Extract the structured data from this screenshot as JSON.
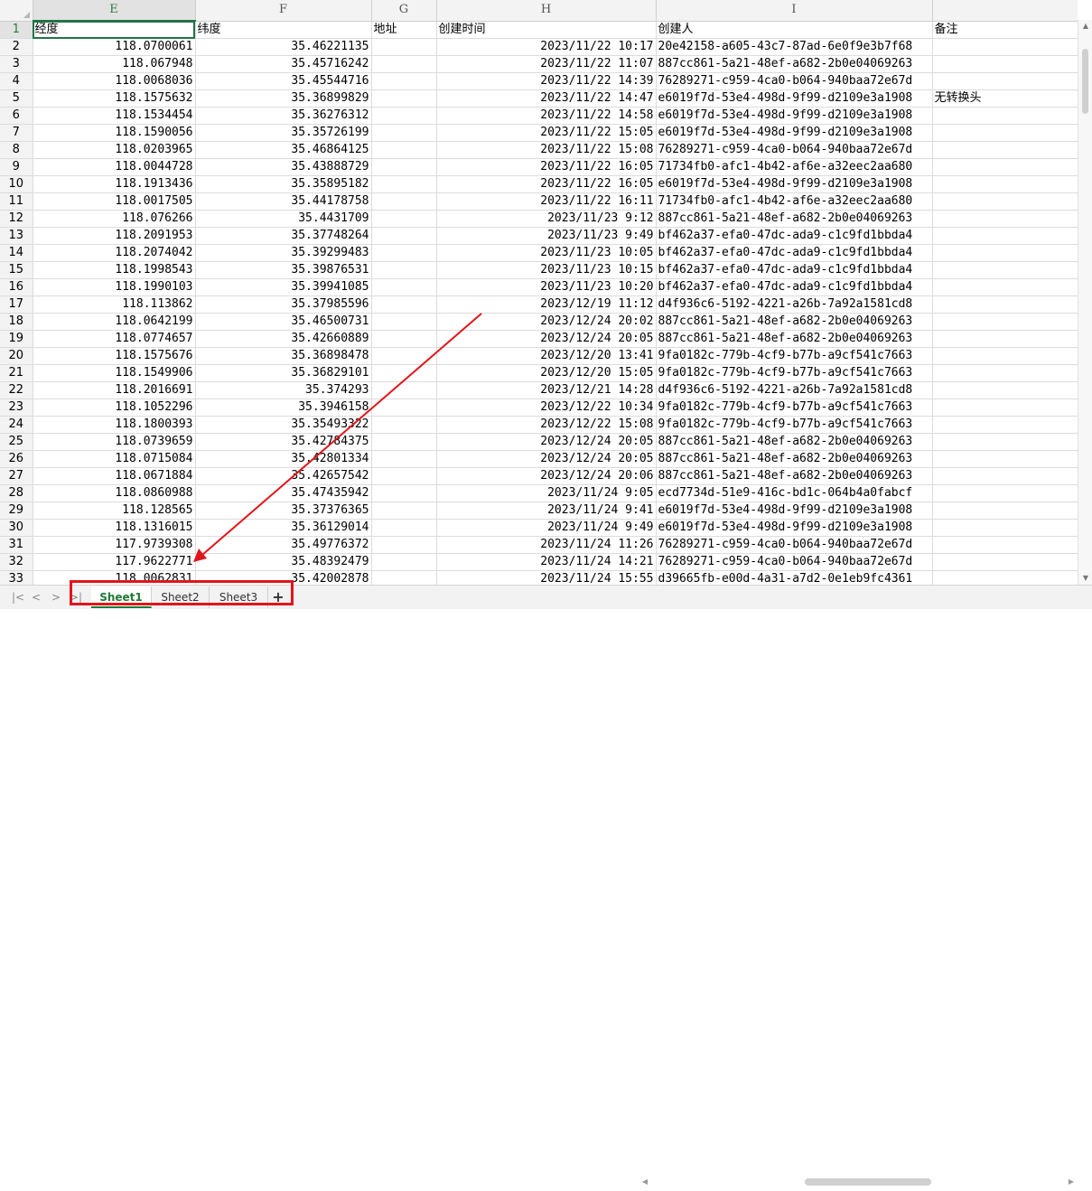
{
  "columns": [
    "E",
    "F",
    "G",
    "H",
    "I",
    ""
  ],
  "header_row": {
    "num": "1",
    "cells": [
      "经度",
      "纬度",
      "地址",
      "创建时间",
      "创建人",
      "备注"
    ]
  },
  "rows": [
    {
      "num": "2",
      "lng": "118.0700061",
      "lat": "35.46221135",
      "addr": "",
      "time": "2023/11/22 10:17",
      "creator": "20e42158-a605-43c7-87ad-6e0f9e3b7f68",
      "note": ""
    },
    {
      "num": "3",
      "lng": "118.067948",
      "lat": "35.45716242",
      "addr": "",
      "time": "2023/11/22 11:07",
      "creator": "887cc861-5a21-48ef-a682-2b0e04069263",
      "note": ""
    },
    {
      "num": "4",
      "lng": "118.0068036",
      "lat": "35.45544716",
      "addr": "",
      "time": "2023/11/22 14:39",
      "creator": "76289271-c959-4ca0-b064-940baa72e67d",
      "note": ""
    },
    {
      "num": "5",
      "lng": "118.1575632",
      "lat": "35.36899829",
      "addr": "",
      "time": "2023/11/22 14:47",
      "creator": "e6019f7d-53e4-498d-9f99-d2109e3a1908",
      "note": "无转换头"
    },
    {
      "num": "6",
      "lng": "118.1534454",
      "lat": "35.36276312",
      "addr": "",
      "time": "2023/11/22 14:58",
      "creator": "e6019f7d-53e4-498d-9f99-d2109e3a1908",
      "note": ""
    },
    {
      "num": "7",
      "lng": "118.1590056",
      "lat": "35.35726199",
      "addr": "",
      "time": "2023/11/22 15:05",
      "creator": "e6019f7d-53e4-498d-9f99-d2109e3a1908",
      "note": ""
    },
    {
      "num": "8",
      "lng": "118.0203965",
      "lat": "35.46864125",
      "addr": "",
      "time": "2023/11/22 15:08",
      "creator": "76289271-c959-4ca0-b064-940baa72e67d",
      "note": ""
    },
    {
      "num": "9",
      "lng": "118.0044728",
      "lat": "35.43888729",
      "addr": "",
      "time": "2023/11/22 16:05",
      "creator": "71734fb0-afc1-4b42-af6e-a32eec2aa680",
      "note": ""
    },
    {
      "num": "10",
      "lng": "118.1913436",
      "lat": "35.35895182",
      "addr": "",
      "time": "2023/11/22 16:05",
      "creator": "e6019f7d-53e4-498d-9f99-d2109e3a1908",
      "note": ""
    },
    {
      "num": "11",
      "lng": "118.0017505",
      "lat": "35.44178758",
      "addr": "",
      "time": "2023/11/22 16:11",
      "creator": "71734fb0-afc1-4b42-af6e-a32eec2aa680",
      "note": ""
    },
    {
      "num": "12",
      "lng": "118.076266",
      "lat": "35.4431709",
      "addr": "",
      "time": "2023/11/23 9:12",
      "creator": "887cc861-5a21-48ef-a682-2b0e04069263",
      "note": ""
    },
    {
      "num": "13",
      "lng": "118.2091953",
      "lat": "35.37748264",
      "addr": "",
      "time": "2023/11/23 9:49",
      "creator": "bf462a37-efa0-47dc-ada9-c1c9fd1bbda4",
      "note": ""
    },
    {
      "num": "14",
      "lng": "118.2074042",
      "lat": "35.39299483",
      "addr": "",
      "time": "2023/11/23 10:05",
      "creator": "bf462a37-efa0-47dc-ada9-c1c9fd1bbda4",
      "note": ""
    },
    {
      "num": "15",
      "lng": "118.1998543",
      "lat": "35.39876531",
      "addr": "",
      "time": "2023/11/23 10:15",
      "creator": "bf462a37-efa0-47dc-ada9-c1c9fd1bbda4",
      "note": ""
    },
    {
      "num": "16",
      "lng": "118.1990103",
      "lat": "35.39941085",
      "addr": "",
      "time": "2023/11/23 10:20",
      "creator": "bf462a37-efa0-47dc-ada9-c1c9fd1bbda4",
      "note": ""
    },
    {
      "num": "17",
      "lng": "118.113862",
      "lat": "35.37985596",
      "addr": "",
      "time": "2023/12/19 11:12",
      "creator": "d4f936c6-5192-4221-a26b-7a92a1581cd8",
      "note": ""
    },
    {
      "num": "18",
      "lng": "118.0642199",
      "lat": "35.46500731",
      "addr": "",
      "time": "2023/12/24 20:02",
      "creator": "887cc861-5a21-48ef-a682-2b0e04069263",
      "note": ""
    },
    {
      "num": "19",
      "lng": "118.0774657",
      "lat": "35.42660889",
      "addr": "",
      "time": "2023/12/24 20:05",
      "creator": "887cc861-5a21-48ef-a682-2b0e04069263",
      "note": ""
    },
    {
      "num": "20",
      "lng": "118.1575676",
      "lat": "35.36898478",
      "addr": "",
      "time": "2023/12/20 13:41",
      "creator": "9fa0182c-779b-4cf9-b77b-a9cf541c7663",
      "note": ""
    },
    {
      "num": "21",
      "lng": "118.1549906",
      "lat": "35.36829101",
      "addr": "",
      "time": "2023/12/20 15:05",
      "creator": "9fa0182c-779b-4cf9-b77b-a9cf541c7663",
      "note": ""
    },
    {
      "num": "22",
      "lng": "118.2016691",
      "lat": "35.374293",
      "addr": "",
      "time": "2023/12/21 14:28",
      "creator": "d4f936c6-5192-4221-a26b-7a92a1581cd8",
      "note": ""
    },
    {
      "num": "23",
      "lng": "118.1052296",
      "lat": "35.3946158",
      "addr": "",
      "time": "2023/12/22 10:34",
      "creator": "9fa0182c-779b-4cf9-b77b-a9cf541c7663",
      "note": ""
    },
    {
      "num": "24",
      "lng": "118.1800393",
      "lat": "35.35493322",
      "addr": "",
      "time": "2023/12/22 15:08",
      "creator": "9fa0182c-779b-4cf9-b77b-a9cf541c7663",
      "note": ""
    },
    {
      "num": "25",
      "lng": "118.0739659",
      "lat": "35.42784375",
      "addr": "",
      "time": "2023/12/24 20:05",
      "creator": "887cc861-5a21-48ef-a682-2b0e04069263",
      "note": ""
    },
    {
      "num": "26",
      "lng": "118.0715084",
      "lat": "35.42801334",
      "addr": "",
      "time": "2023/12/24 20:05",
      "creator": "887cc861-5a21-48ef-a682-2b0e04069263",
      "note": ""
    },
    {
      "num": "27",
      "lng": "118.0671884",
      "lat": "35.42657542",
      "addr": "",
      "time": "2023/12/24 20:06",
      "creator": "887cc861-5a21-48ef-a682-2b0e04069263",
      "note": ""
    },
    {
      "num": "28",
      "lng": "118.0860988",
      "lat": "35.47435942",
      "addr": "",
      "time": "2023/11/24 9:05",
      "creator": "ecd7734d-51e9-416c-bd1c-064b4a0fabcf",
      "note": ""
    },
    {
      "num": "29",
      "lng": "118.128565",
      "lat": "35.37376365",
      "addr": "",
      "time": "2023/11/24 9:41",
      "creator": "e6019f7d-53e4-498d-9f99-d2109e3a1908",
      "note": ""
    },
    {
      "num": "30",
      "lng": "118.1316015",
      "lat": "35.36129014",
      "addr": "",
      "time": "2023/11/24 9:49",
      "creator": "e6019f7d-53e4-498d-9f99-d2109e3a1908",
      "note": ""
    },
    {
      "num": "31",
      "lng": "117.9739308",
      "lat": "35.49776372",
      "addr": "",
      "time": "2023/11/24 11:26",
      "creator": "76289271-c959-4ca0-b064-940baa72e67d",
      "note": ""
    },
    {
      "num": "32",
      "lng": "117.9622771",
      "lat": "35.48392479",
      "addr": "",
      "time": "2023/11/24 14:21",
      "creator": "76289271-c959-4ca0-b064-940baa72e67d",
      "note": ""
    },
    {
      "num": "33",
      "lng": "118.0062831",
      "lat": "35.42002878",
      "addr": "",
      "time": "2023/11/24 15:55",
      "creator": "d39665fb-e00d-4a31-a7d2-0e1eb9fc4361",
      "note": ""
    }
  ],
  "sheet_tabs": [
    "Sheet1",
    "Sheet2",
    "Sheet3"
  ],
  "active_tab": "Sheet1",
  "add_tab_label": "+",
  "nav_buttons": [
    "|<",
    "<",
    ">",
    ">|"
  ],
  "colors": {
    "annotation": "#e0151b",
    "accent": "#217346"
  }
}
